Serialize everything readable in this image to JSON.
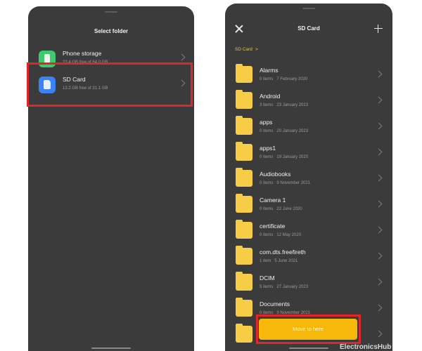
{
  "left_screen": {
    "title": "Select folder",
    "storages": [
      {
        "name": "Phone storage",
        "details": "23.4 GB free of 64.0 GB",
        "icon": "phone-icon",
        "color": "#3ec86f"
      },
      {
        "name": "SD Card",
        "details": "13.2 GB free of 31.1 GB",
        "icon": "sd-card-icon",
        "color": "#3b82f6"
      }
    ]
  },
  "right_screen": {
    "title": "SD Card",
    "breadcrumb": "SD Card",
    "breadcrumb_separator": ">",
    "folders": [
      {
        "name": "Alarms",
        "items": "0 items",
        "date": "7 February 2020"
      },
      {
        "name": "Android",
        "items": "3 items",
        "date": "23 January 2023"
      },
      {
        "name": "apps",
        "items": "0 items",
        "date": "20 January 2023"
      },
      {
        "name": "apps1",
        "items": "0 items",
        "date": "19 January 2020"
      },
      {
        "name": "Audiobooks",
        "items": "0 items",
        "date": "9 November 2021"
      },
      {
        "name": "Camera 1",
        "items": "0 items",
        "date": "22 June 2020"
      },
      {
        "name": "certificate",
        "items": "0 items",
        "date": "12 May 2020"
      },
      {
        "name": "com.dts.freefireth",
        "items": "1 item",
        "date": "5 June 2021"
      },
      {
        "name": "DCIM",
        "items": "5 items",
        "date": "27 January 2023"
      },
      {
        "name": "Documents",
        "items": "0 items",
        "date": "9 November 2021"
      },
      {
        "name": "",
        "items": "",
        "date": ""
      }
    ],
    "move_button_label": "Move to here"
  },
  "highlight_color": "#e0262b",
  "accent_color": "#f6b90a",
  "watermark": "ElectronicsHub"
}
